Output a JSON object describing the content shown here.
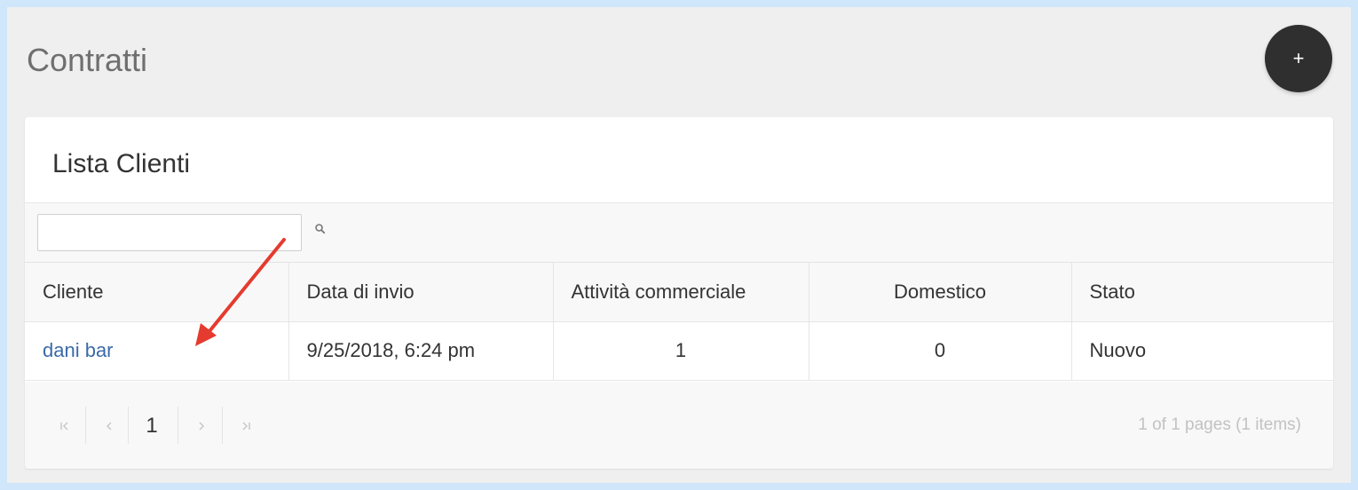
{
  "page": {
    "title": "Contratti",
    "add_button_label": "+"
  },
  "card": {
    "title": "Lista Clienti",
    "search": {
      "value": "",
      "placeholder": ""
    }
  },
  "table": {
    "columns": [
      "Cliente",
      "Data di invio",
      "Attività commerciale",
      "Domestico",
      "Stato"
    ],
    "rows": [
      {
        "cliente": "dani bar",
        "data_invio": "9/25/2018, 6:24 pm",
        "attivita_commerciale": "1",
        "domestico": "0",
        "stato": "Nuovo"
      }
    ]
  },
  "pager": {
    "current_page": "1",
    "summary": "1 of 1 pages (1 items)"
  },
  "colors": {
    "link": "#3b6aa8",
    "fab": "#2f2f2f",
    "annotation_arrow": "#e53b2f"
  }
}
